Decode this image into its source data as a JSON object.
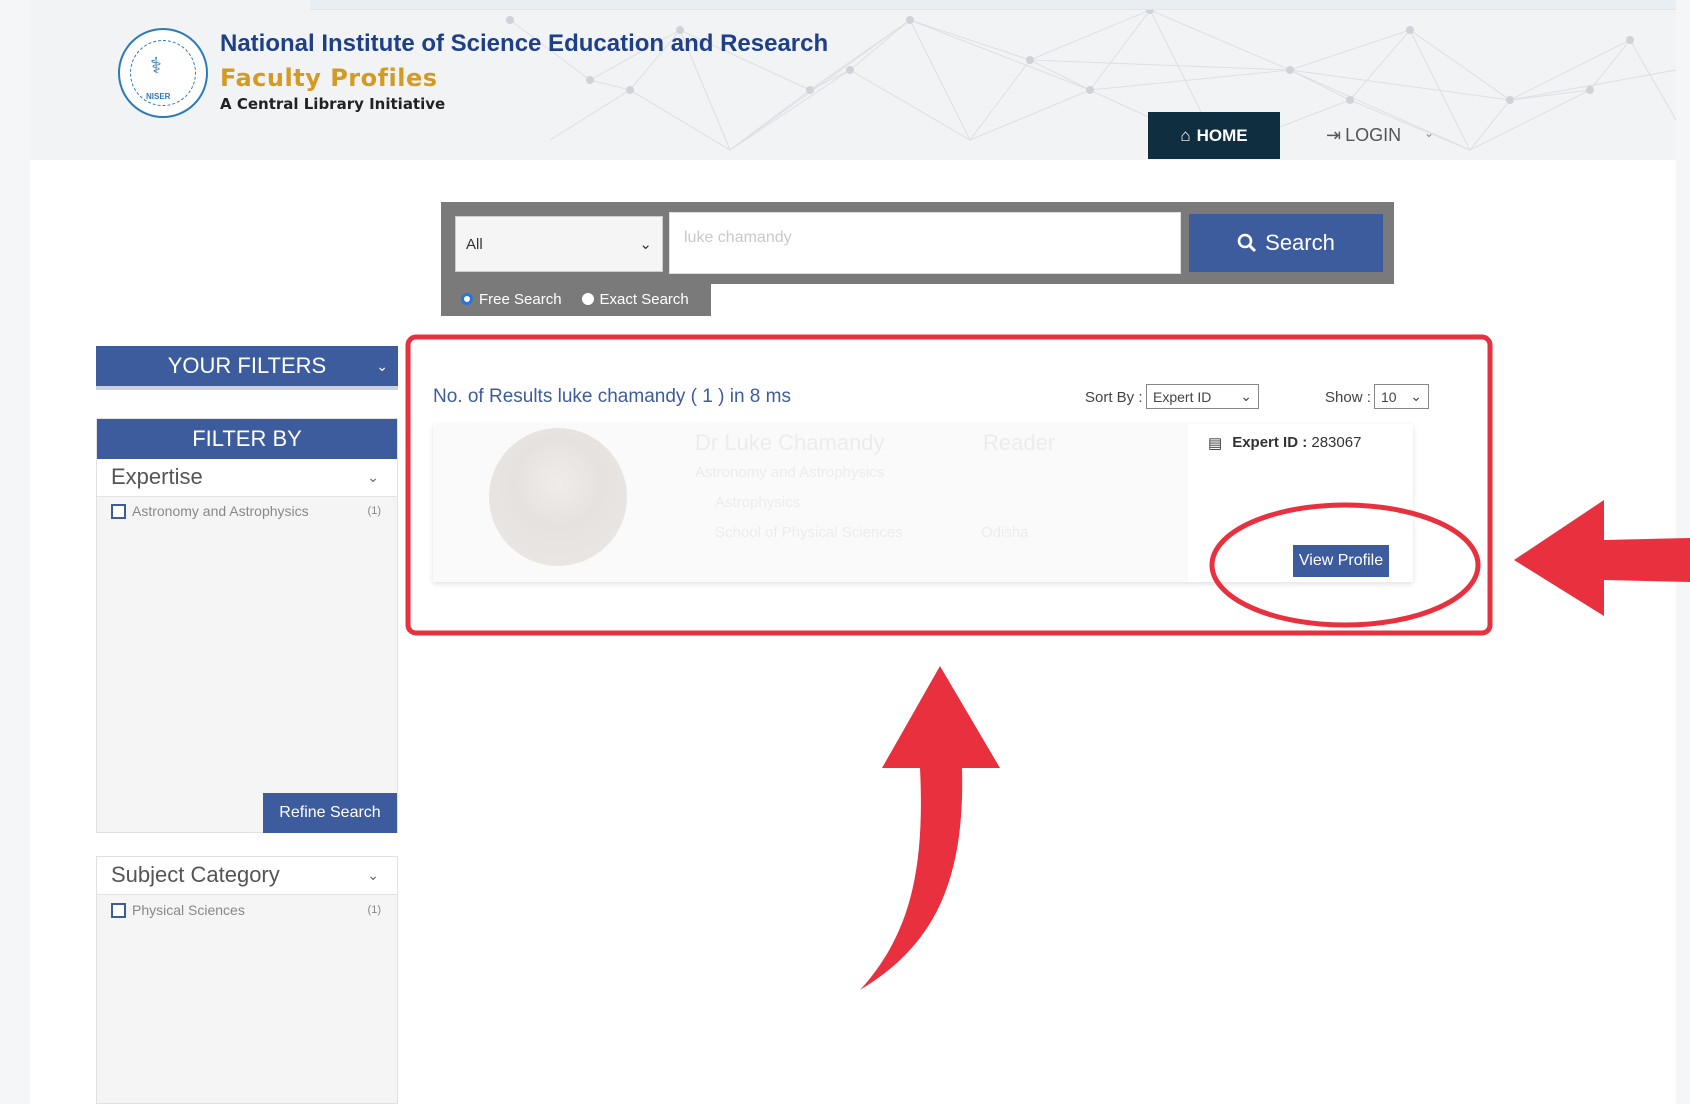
{
  "header": {
    "institute": "National Institute of Science Education and Research",
    "subtitle": "Faculty Profiles",
    "tagline": "A Central Library Initiative",
    "logo_text": "NISER",
    "nav": {
      "home_label": "HOME",
      "login_label": "LOGIN"
    }
  },
  "search": {
    "category_selected": "All",
    "query_value": "luke chamandy",
    "button_label": "Search",
    "modes": [
      {
        "label": "Free Search",
        "selected": true
      },
      {
        "label": "Exact Search",
        "selected": false
      }
    ]
  },
  "sidebar": {
    "your_filters_label": "YOUR FILTERS",
    "filter_by_label": "FILTER BY",
    "facets": [
      {
        "title": "Expertise",
        "items": [
          {
            "label": "Astronomy and Astrophysics",
            "count": "(1)"
          }
        ]
      },
      {
        "title": "Subject Category",
        "items": [
          {
            "label": "Physical Sciences",
            "count": "(1)"
          }
        ]
      }
    ],
    "refine_label": "Refine Search"
  },
  "results": {
    "summary": "No. of Results luke chamandy ( 1 ) in 8 ms",
    "sort_label": "Sort By :",
    "sort_value": "Expert ID",
    "show_label": "Show :",
    "show_value": "10",
    "items": [
      {
        "name": "Dr Luke Chamandy",
        "designation": "Reader",
        "expertise": "Astronomy and Astrophysics",
        "topic": "Astrophysics",
        "school": "School of Physical Sciences",
        "state": "Odisha",
        "expert_id_label": "Expert ID :",
        "expert_id": "283067",
        "view_label": "View Profile"
      }
    ]
  },
  "colors": {
    "primary": "#3d5c9e",
    "nav_dark": "#0f2f40",
    "brand_blue": "#1f3f86",
    "brand_gold": "#d49a22",
    "annotation_red": "#e8303f"
  },
  "icons": {
    "home": "home-icon",
    "login": "sign-in-icon",
    "search": "search-icon",
    "expert_id": "id-card-icon"
  }
}
